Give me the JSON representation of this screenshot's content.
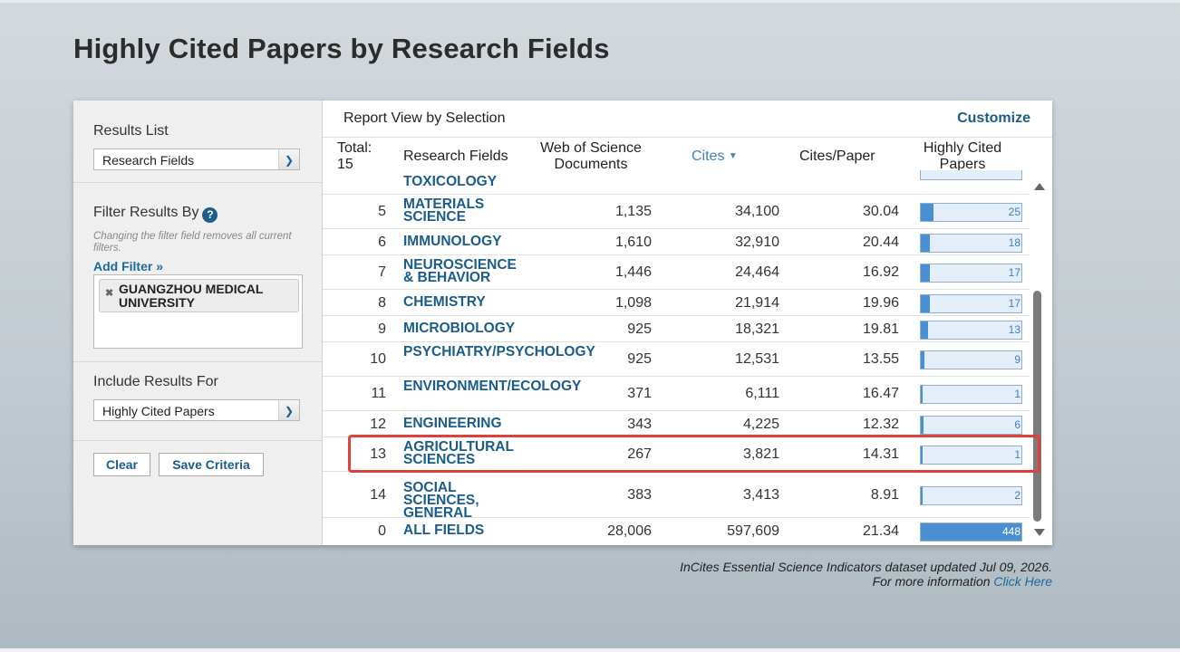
{
  "page": {
    "title": "Highly Cited Papers by Research Fields"
  },
  "sidebar": {
    "results_list_label": "Results List",
    "results_list_value": "Research Fields",
    "filter_label": "Filter Results By",
    "help_glyph": "?",
    "filter_note": "Changing the filter field removes all current filters.",
    "add_filter": "Add Filter »",
    "filter_chip": "GUANGZHOU MEDICAL UNIVERSITY",
    "include_label": "Include Results For",
    "include_value": "Highly Cited Papers",
    "clear_label": "Clear",
    "save_label": "Save Criteria"
  },
  "report": {
    "view_title": "Report View by Selection",
    "customize": "Customize",
    "columns": {
      "total": "Total: 15",
      "field": "Research Fields",
      "wos": "Web of Science Documents",
      "cites": "Cites",
      "cpp": "Cites/Paper",
      "hcp": "Highly Cited Papers"
    },
    "partial_row_field": "TOXICOLOGY",
    "rows": [
      {
        "rank": "5",
        "field": "MATERIALS SCIENCE",
        "wos": "1,135",
        "cites": "34,100",
        "cpp": "30.04",
        "hcp": "25",
        "hcp_fraction": 0.13
      },
      {
        "rank": "6",
        "field": "IMMUNOLOGY",
        "wos": "1,610",
        "cites": "32,910",
        "cpp": "20.44",
        "hcp": "18",
        "hcp_fraction": 0.09
      },
      {
        "rank": "7",
        "field": "NEUROSCIENCE & BEHAVIOR",
        "wos": "1,446",
        "cites": "24,464",
        "cpp": "16.92",
        "hcp": "17",
        "hcp_fraction": 0.09
      },
      {
        "rank": "8",
        "field": "CHEMISTRY",
        "wos": "1,098",
        "cites": "21,914",
        "cpp": "19.96",
        "hcp": "17",
        "hcp_fraction": 0.09
      },
      {
        "rank": "9",
        "field": "MICROBIOLOGY",
        "wos": "925",
        "cites": "18,321",
        "cpp": "19.81",
        "hcp": "13",
        "hcp_fraction": 0.07
      },
      {
        "rank": "10",
        "field": "PSYCHIATRY/PSYCHOLOGY",
        "wos": "925",
        "cites": "12,531",
        "cpp": "13.55",
        "hcp": "9",
        "hcp_fraction": 0.04
      },
      {
        "rank": "11",
        "field": "ENVIRONMENT/ECOLOGY",
        "wos": "371",
        "cites": "6,111",
        "cpp": "16.47",
        "hcp": "1",
        "hcp_fraction": 0.01
      },
      {
        "rank": "12",
        "field": "ENGINEERING",
        "wos": "343",
        "cites": "4,225",
        "cpp": "12.32",
        "hcp": "6",
        "hcp_fraction": 0.03
      },
      {
        "rank": "13",
        "field": "AGRICULTURAL SCIENCES",
        "wos": "267",
        "cites": "3,821",
        "cpp": "14.31",
        "hcp": "1",
        "hcp_fraction": 0.01
      },
      {
        "rank": "14",
        "field": "SOCIAL SCIENCES, GENERAL",
        "wos": "383",
        "cites": "3,413",
        "cpp": "8.91",
        "hcp": "2",
        "hcp_fraction": 0.01
      },
      {
        "rank": "0",
        "field": "ALL FIELDS",
        "wos": "28,006",
        "cites": "597,609",
        "cpp": "21.34",
        "hcp": "448",
        "hcp_fraction": 1.0
      }
    ]
  },
  "footer": {
    "line1": "InCites Essential Science Indicators dataset updated Jul 09, 2026.",
    "line2": "For more information",
    "link": "Click Here"
  },
  "colors": {
    "accent": "#1a5c8a",
    "highlight": "#e0403a",
    "bar_fill": "#4a8fd1"
  }
}
